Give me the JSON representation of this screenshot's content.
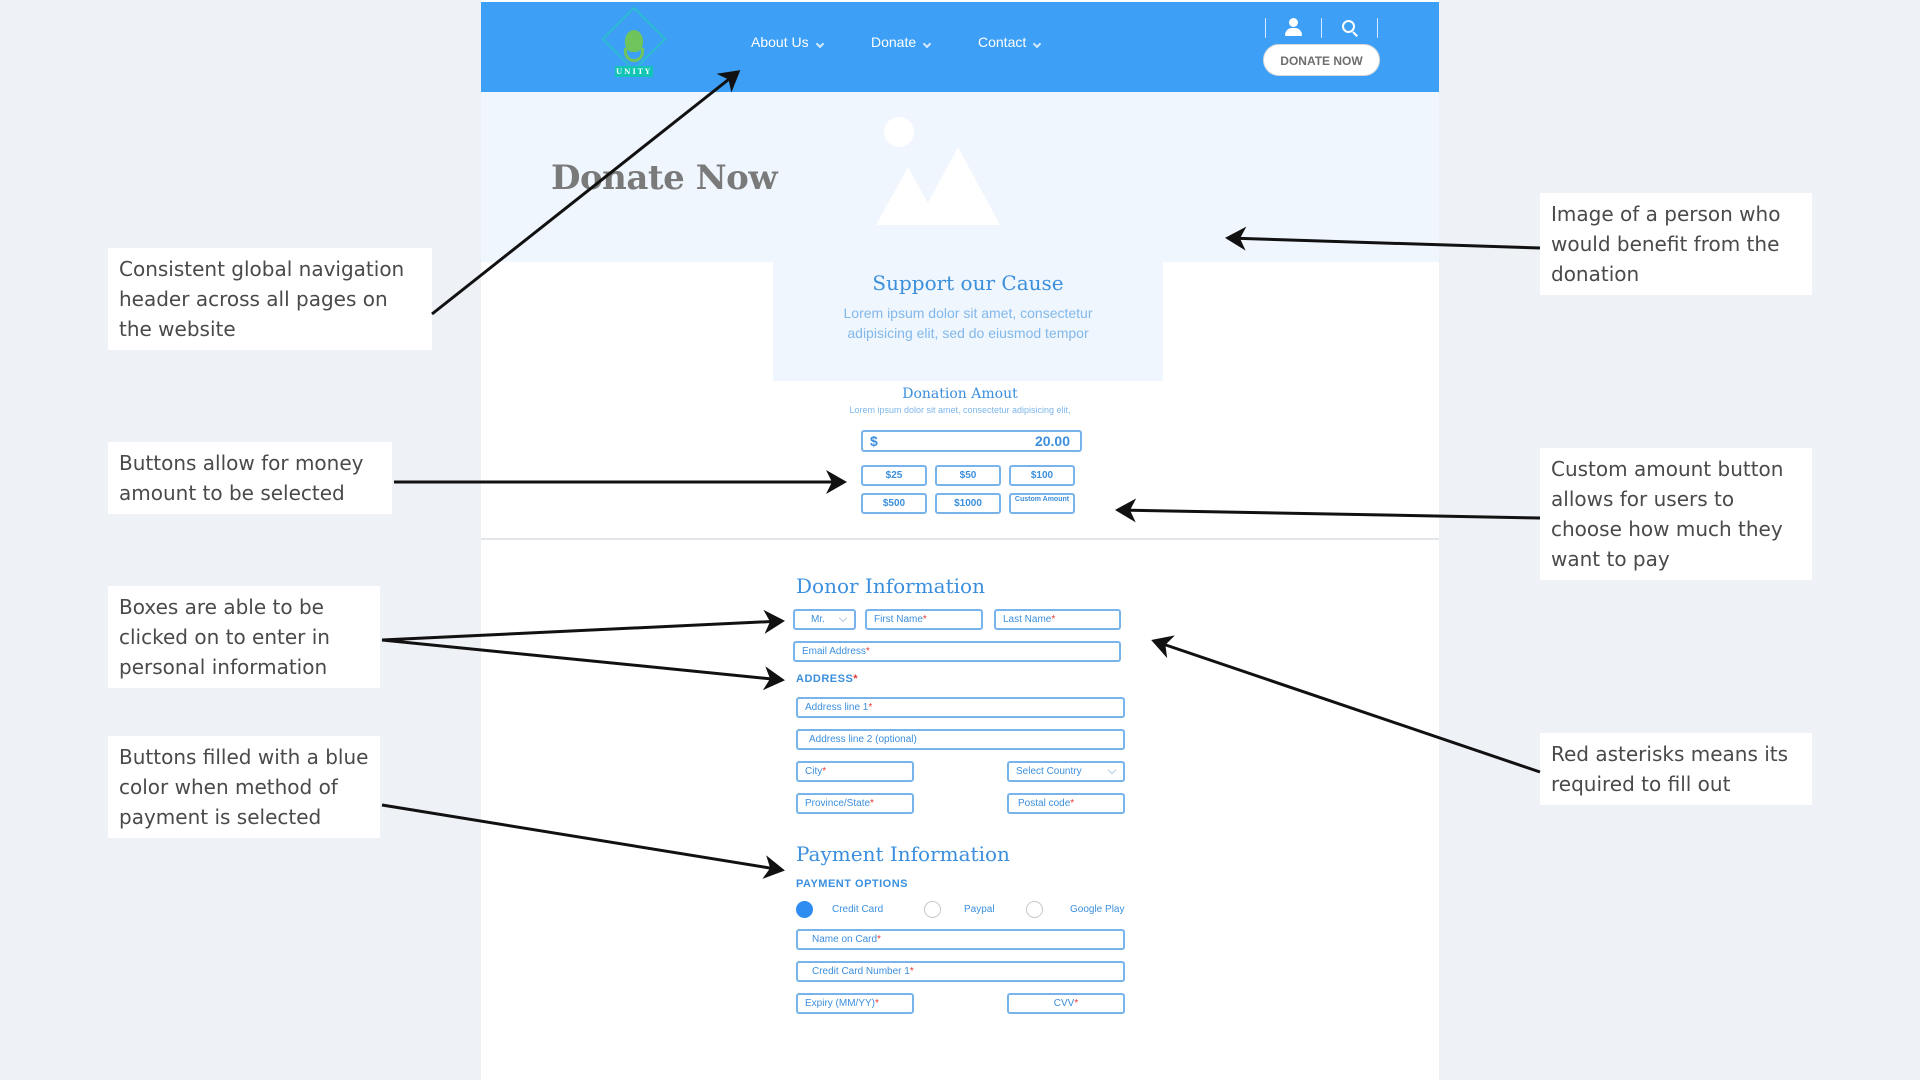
{
  "header": {
    "logo_text": "UNITY",
    "nav": [
      {
        "label": "About Us"
      },
      {
        "label": "Donate"
      },
      {
        "label": "Contact"
      }
    ],
    "icons": [
      "user-icon",
      "search-icon"
    ],
    "donate_button": "DONATE NOW",
    "brand_color": "#3d9ff5"
  },
  "hero": {
    "title": "Donate Now",
    "image_placeholder": "image-placeholder-icon"
  },
  "support": {
    "title": "Support our Cause",
    "text": "Lorem ipsum dolor sit amet, consectetur adipisicing elit, sed do eiusmod tempor"
  },
  "donation": {
    "title": "Donation Amout",
    "subtitle": "Lorem ipsum dolor sit amet, consectetur adipisicing elit,",
    "currency": "$",
    "amount": "20.00",
    "buttons": [
      "$25",
      "$50",
      "$100",
      "$500",
      "$1000",
      "Custom Amount"
    ]
  },
  "donor": {
    "title": "Donor Information",
    "salutation": "Mr.",
    "first_name": "First Name",
    "last_name": "Last Name",
    "email": "Email Address",
    "address_label": "ADDRESS",
    "address1": "Address line 1",
    "address2": "Address line 2 (optional)",
    "city": "City",
    "country": "Select Country",
    "province": "Province/State",
    "postal": "Postal code",
    "required_mark": "*"
  },
  "payment": {
    "title": "Payment Information",
    "options_label": "PAYMENT OPTIONS",
    "options": [
      {
        "label": "Credit Card",
        "selected": true
      },
      {
        "label": "Paypal",
        "selected": false
      },
      {
        "label": "Google Play",
        "selected": false
      }
    ],
    "name_on_card": "Name on Card",
    "card_number": "Credit Card Number 1",
    "expiry": "Expiry (MM/YY)",
    "cvv": "CVV"
  },
  "annotations": [
    "Consistent global navigation header across all pages on the website",
    "Buttons allow for money amount to be selected",
    "Boxes are able to be clicked on to enter in personal information",
    "Buttons filled with a blue color when method of payment is selected",
    "Image of a person who would benefit from the donation",
    "Custom amount button allows for users to choose how much they want to pay",
    "Red asterisks means its required to fill out"
  ]
}
